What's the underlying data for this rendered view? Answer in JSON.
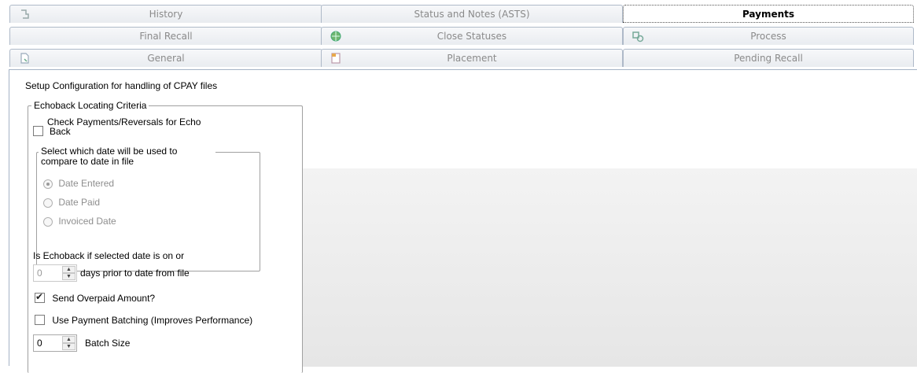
{
  "tabs": {
    "row1": [
      "History",
      "Status and Notes (ASTS)",
      "Payments"
    ],
    "row2": [
      "Final Recall",
      "Close Statuses",
      "Process"
    ],
    "row3": [
      "General",
      "Placement",
      "Pending Recall"
    ],
    "active": "Payments"
  },
  "panel": {
    "setup_text": "Setup Configuration for handling of CPAY files",
    "group_title": "Echoback Locating Criteria",
    "check_echo_line1": "Check Payments/Reversals for Echo",
    "check_echo_line2": "Back",
    "check_echo_checked": false,
    "date_group_line1": "Select which date will be used to",
    "date_group_line2": "compare to date in file",
    "radios": [
      {
        "label": "Date Entered",
        "selected": true
      },
      {
        "label": "Date Paid",
        "selected": false
      },
      {
        "label": "Invoiced Date",
        "selected": false
      }
    ],
    "echoback_text": "Is Echoback if selected date is on or",
    "days_value": "0",
    "days_text": "days prior to date from file",
    "send_overpaid_label": "Send Overpaid Amount?",
    "send_overpaid_checked": true,
    "use_batching_label": "Use Payment Batching (Improves Performance)",
    "use_batching_checked": false,
    "batch_value": "0",
    "batch_label": "Batch Size"
  }
}
